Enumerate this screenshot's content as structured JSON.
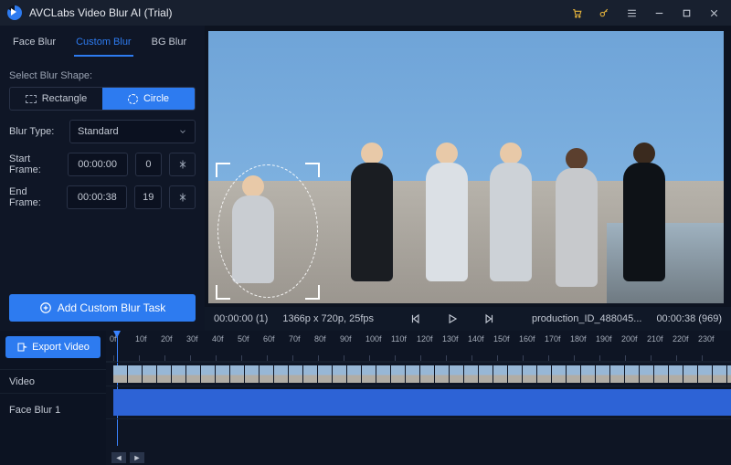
{
  "app": {
    "title": "AVCLabs Video Blur AI (Trial)"
  },
  "tabs": {
    "face": "Face Blur",
    "custom": "Custom Blur",
    "bg": "BG Blur"
  },
  "shape": {
    "label": "Select Blur Shape:",
    "rect": "Rectangle",
    "circle": "Circle"
  },
  "blurType": {
    "label": "Blur Type:",
    "value": "Standard"
  },
  "startFrame": {
    "label": "Start Frame:",
    "time": "00:00:00",
    "index": "0"
  },
  "endFrame": {
    "label": "End Frame:",
    "time": "00:00:38",
    "index": "19"
  },
  "addTask": "Add Custom Blur Task",
  "player": {
    "startStamp": "00:00:00 (1)",
    "meta": "1366p x 720p, 25fps",
    "filename": "production_ID_488045...",
    "endStamp": "00:00:38 (969)"
  },
  "export": "Export Video",
  "tracks": {
    "video": "Video",
    "face1": "Face Blur 1"
  },
  "ruler": [
    "0f",
    "10f",
    "20f",
    "30f",
    "40f",
    "50f",
    "60f",
    "70f",
    "80f",
    "90f",
    "100f",
    "110f",
    "120f",
    "130f",
    "140f",
    "150f",
    "160f",
    "170f",
    "180f",
    "190f",
    "200f",
    "210f",
    "220f",
    "230f"
  ]
}
